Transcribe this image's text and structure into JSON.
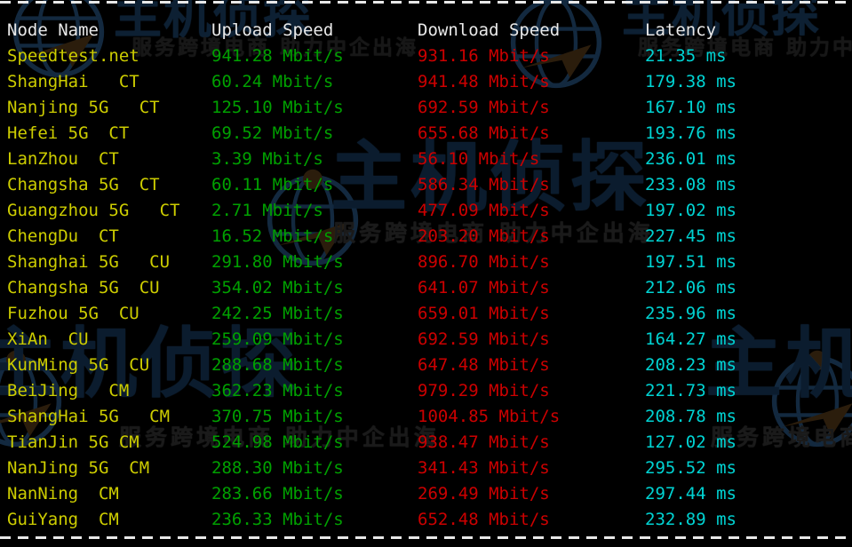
{
  "terminal": {
    "title": "speedtest-results",
    "columns": {
      "node": "Node Name",
      "upload": "Upload Speed",
      "download": "Download Speed",
      "latency": "Latency"
    },
    "units": {
      "speed": "Mbit/s",
      "latency": "ms"
    },
    "colors": {
      "background": "#000000",
      "header": "#e9e9e9",
      "node": "#cdcd00",
      "upload": "#00a000",
      "download": "#cc0000",
      "latency": "#00d3d3",
      "rule": "#e8e8e8",
      "watermark": "#0d2033"
    },
    "rows": [
      {
        "node": "Speedtest.net",
        "upload": "941.28 Mbit/s",
        "download": "931.16 Mbit/s",
        "latency": "21.35 ms"
      },
      {
        "node": "ShangHai   CT",
        "upload": "60.24 Mbit/s",
        "download": "941.48 Mbit/s",
        "latency": "179.38 ms"
      },
      {
        "node": "Nanjing 5G   CT",
        "upload": "125.10 Mbit/s",
        "download": "692.59 Mbit/s",
        "latency": "167.10 ms"
      },
      {
        "node": "Hefei 5G  CT",
        "upload": "69.52 Mbit/s",
        "download": "655.68 Mbit/s",
        "latency": "193.76 ms"
      },
      {
        "node": "LanZhou  CT",
        "upload": "3.39 Mbit/s",
        "download": "56.10 Mbit/s",
        "latency": "236.01 ms"
      },
      {
        "node": "Changsha 5G  CT",
        "upload": "60.11 Mbit/s",
        "download": "586.34 Mbit/s",
        "latency": "233.08 ms"
      },
      {
        "node": "Guangzhou 5G   CT",
        "upload": "2.71 Mbit/s",
        "download": "477.09 Mbit/s",
        "latency": "197.02 ms"
      },
      {
        "node": "ChengDu  CT",
        "upload": "16.52 Mbit/s",
        "download": "203.20 Mbit/s",
        "latency": "227.45 ms"
      },
      {
        "node": "Shanghai 5G   CU",
        "upload": "291.80 Mbit/s",
        "download": "896.70 Mbit/s",
        "latency": "197.51 ms"
      },
      {
        "node": "Changsha 5G  CU",
        "upload": "354.02 Mbit/s",
        "download": "641.07 Mbit/s",
        "latency": "212.06 ms"
      },
      {
        "node": "Fuzhou 5G  CU",
        "upload": "242.25 Mbit/s",
        "download": "659.01 Mbit/s",
        "latency": "235.96 ms"
      },
      {
        "node": "XiAn  CU",
        "upload": "259.09 Mbit/s",
        "download": "692.59 Mbit/s",
        "latency": "164.27 ms"
      },
      {
        "node": "KunMing 5G  CU",
        "upload": "288.68 Mbit/s",
        "download": "647.48 Mbit/s",
        "latency": "208.23 ms"
      },
      {
        "node": "BeiJing   CM",
        "upload": "362.23 Mbit/s",
        "download": "979.29 Mbit/s",
        "latency": "221.73 ms"
      },
      {
        "node": "ShangHai 5G   CM",
        "upload": "370.75 Mbit/s",
        "download": "1004.85 Mbit/s",
        "latency": "208.78 ms"
      },
      {
        "node": "TianJin 5G CM",
        "upload": "524.98 Mbit/s",
        "download": "938.47 Mbit/s",
        "latency": "127.02 ms"
      },
      {
        "node": "NanJing 5G  CM",
        "upload": "288.30 Mbit/s",
        "download": "341.43 Mbit/s",
        "latency": "295.52 ms"
      },
      {
        "node": "NanNing  CM",
        "upload": "283.66 Mbit/s",
        "download": "269.49 Mbit/s",
        "latency": "297.44 ms"
      },
      {
        "node": "GuiYang  CM",
        "upload": "236.33 Mbit/s",
        "download": "652.48 Mbit/s",
        "latency": "232.89 ms"
      }
    ]
  },
  "watermark": {
    "brand_cn": "主机侦探",
    "tagline_cn": "服务跨境电商 助力中企出海",
    "emblem": "globe-arrow-icon"
  }
}
